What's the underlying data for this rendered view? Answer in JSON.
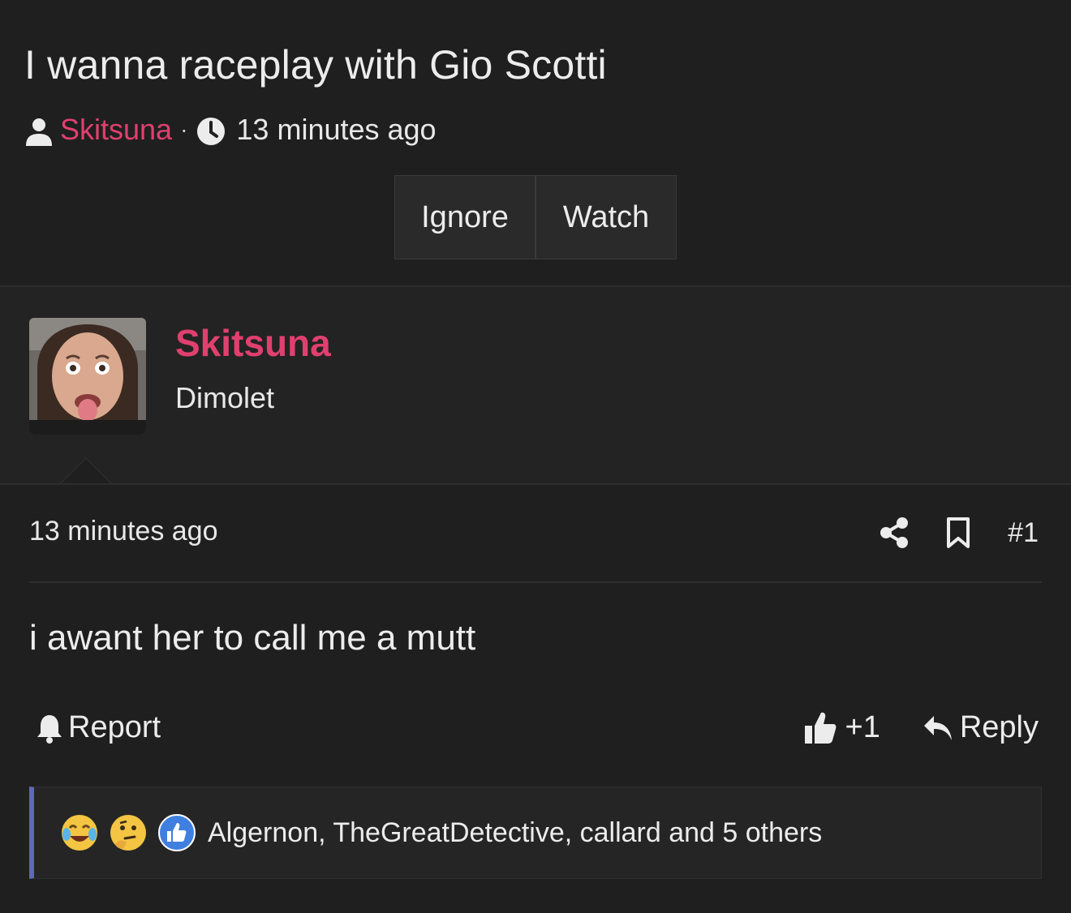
{
  "thread": {
    "title": "I wanna raceplay with Gio Scotti",
    "author": "Skitsuna",
    "separator": "·",
    "time": "13 minutes ago",
    "buttons": {
      "ignore": "Ignore",
      "watch": "Watch"
    }
  },
  "post": {
    "username": "Skitsuna",
    "user_title": "Dimolet",
    "time": "13 minutes ago",
    "number": "#1",
    "body": "i awant her to call me a mutt",
    "report_label": "Report",
    "like_count": "+1",
    "reply_label": "Reply",
    "reactions": {
      "icons": [
        "laughing-crying-emoji",
        "thinking-emoji",
        "thumbs-up-reaction"
      ],
      "text": "Algernon, TheGreatDetective, callard and 5 others"
    }
  },
  "colors": {
    "background": "#1f1f1f",
    "accent_username": "#e0406f",
    "reaction_border": "#5f69b8"
  }
}
